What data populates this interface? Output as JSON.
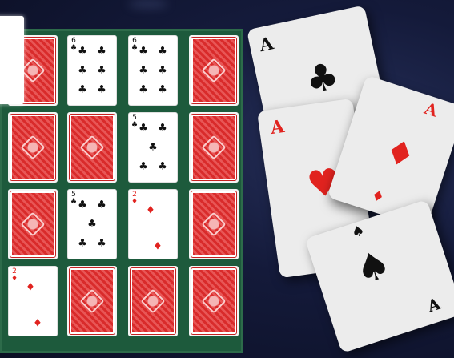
{
  "board": {
    "columns": 4,
    "rows": 4,
    "cards": [
      {
        "row": 0,
        "col": 0,
        "state": "face-down"
      },
      {
        "row": 0,
        "col": 1,
        "state": "face-up",
        "rank": "6",
        "suit": "clubs",
        "suit_symbol": "♣",
        "color": "black"
      },
      {
        "row": 0,
        "col": 2,
        "state": "face-up",
        "rank": "6",
        "suit": "clubs",
        "suit_symbol": "♣",
        "color": "black"
      },
      {
        "row": 0,
        "col": 3,
        "state": "face-down"
      },
      {
        "row": 1,
        "col": 0,
        "state": "face-down"
      },
      {
        "row": 1,
        "col": 1,
        "state": "face-down"
      },
      {
        "row": 1,
        "col": 2,
        "state": "face-up",
        "rank": "5",
        "suit": "clubs",
        "suit_symbol": "♣",
        "color": "black"
      },
      {
        "row": 1,
        "col": 3,
        "state": "face-down"
      },
      {
        "row": 2,
        "col": 0,
        "state": "face-down"
      },
      {
        "row": 2,
        "col": 1,
        "state": "face-up",
        "rank": "5",
        "suit": "clubs",
        "suit_symbol": "♣",
        "color": "black"
      },
      {
        "row": 2,
        "col": 2,
        "state": "face-up",
        "rank": "2",
        "suit": "diamonds",
        "suit_symbol": "♦",
        "color": "red"
      },
      {
        "row": 2,
        "col": 3,
        "state": "face-down"
      },
      {
        "row": 3,
        "col": 0,
        "state": "face-up",
        "rank": "2",
        "suit": "diamonds",
        "suit_symbol": "♦",
        "color": "red"
      },
      {
        "row": 3,
        "col": 1,
        "state": "face-down"
      },
      {
        "row": 3,
        "col": 2,
        "state": "face-down"
      },
      {
        "row": 3,
        "col": 3,
        "state": "face-down"
      }
    ]
  },
  "decorative_fan": [
    {
      "rank": "A",
      "suit": "clubs",
      "symbol": "♣",
      "color": "#111111"
    },
    {
      "rank": "A",
      "suit": "hearts",
      "symbol": "♥",
      "color": "#e1231f"
    },
    {
      "rank": "A",
      "suit": "diamonds",
      "symbol": "♦",
      "color": "#e1231f"
    },
    {
      "rank": "A",
      "suit": "spades",
      "symbol": "♠",
      "color": "#111111"
    }
  ],
  "colors": {
    "table_green": "#1d5a3c",
    "card_back_red": "#d92b2b",
    "background": "#141a3a"
  }
}
